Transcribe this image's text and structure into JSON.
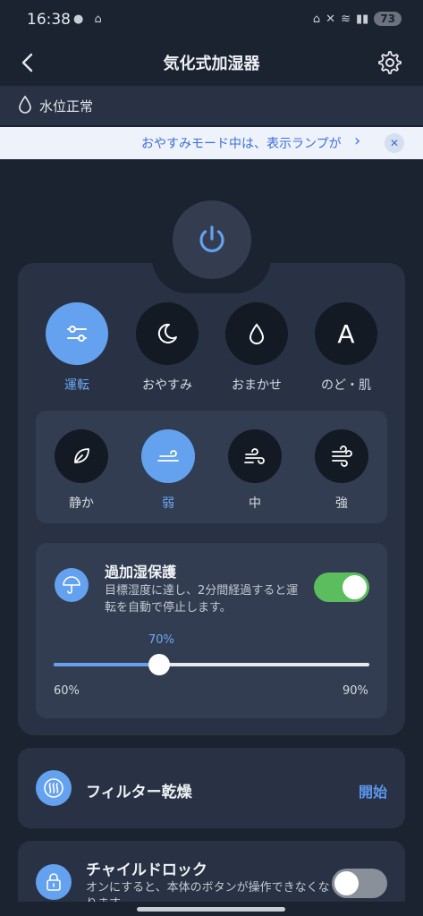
{
  "status_bar": {
    "time": "16:38",
    "battery": "73"
  },
  "app_bar": {
    "back_icon": "chevron-left",
    "title": "気化式加湿器",
    "settings_icon": "gear-icon"
  },
  "water_status": {
    "icon": "water-drop-icon",
    "text": "水位正常"
  },
  "notice": {
    "text": "おやすみモード中は、表示ランプが",
    "chevron": "›",
    "close": "✕"
  },
  "power": {
    "icon": "power-icon"
  },
  "modes": [
    {
      "label": "運転",
      "icon": "sliders-icon",
      "active": true
    },
    {
      "label": "おやすみ",
      "icon": "moon-icon",
      "active": false
    },
    {
      "label": "おまかせ",
      "icon": "drop-icon",
      "active": false
    },
    {
      "label": "のど・肌",
      "icon": "letter-a-icon",
      "glyph": "A",
      "active": false
    }
  ],
  "fan_speeds": [
    {
      "label": "静か",
      "icon": "leaf-icon",
      "active": false
    },
    {
      "label": "弱",
      "icon": "wind-low-icon",
      "active": true
    },
    {
      "label": "中",
      "icon": "wind-mid-icon",
      "active": false
    },
    {
      "label": "強",
      "icon": "wind-high-icon",
      "active": false
    }
  ],
  "over_humidify": {
    "title": "過加湿保護",
    "description": "目標湿度に達し、2分間経過すると運転を自動で停止します。",
    "enabled": true,
    "slider": {
      "value_label": "70%",
      "value": 70,
      "min": 60,
      "max": 90,
      "min_label": "60%",
      "max_label": "90%"
    }
  },
  "filter_dry": {
    "title": "フィルター乾燥",
    "action": "開始"
  },
  "child_lock": {
    "title": "チャイルドロック",
    "description": "オンにすると、本体のボタンが操作できなくなります。",
    "enabled": false
  },
  "colors": {
    "accent": "#64a1ef",
    "background": "#1b2230",
    "card": "#283244",
    "toggle_on": "#5cbd5f"
  }
}
